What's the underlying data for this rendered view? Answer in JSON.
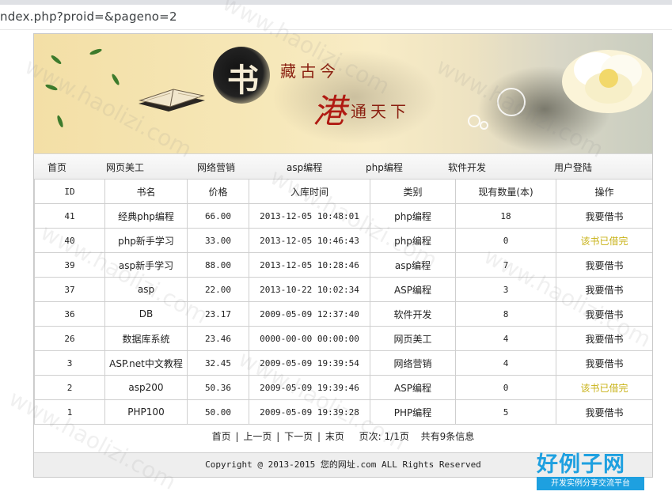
{
  "browser": {
    "url": "ndex.php?proid=&pageno=2"
  },
  "banner": {
    "glyph": "书",
    "line1": "藏古今",
    "line2": "港",
    "line3": "通天下"
  },
  "nav": [
    "首页",
    "网页美工",
    "网络营销",
    "asp编程",
    "php编程",
    "软件开发",
    "用户登陆"
  ],
  "table": {
    "headers": [
      "ID",
      "书名",
      "价格",
      "入库时间",
      "类别",
      "现有数量(本)",
      "操作"
    ],
    "rows": [
      {
        "id": "41",
        "name": "经典php编程",
        "price": "66.00",
        "time": "2013-12-05 10:48:01",
        "category": "php编程",
        "qty": "18",
        "action": "我要借书",
        "action_state": "available"
      },
      {
        "id": "40",
        "name": "php新手学习",
        "price": "33.00",
        "time": "2013-12-05 10:46:43",
        "category": "php编程",
        "qty": "0",
        "action": "该书已借完",
        "action_state": "out"
      },
      {
        "id": "39",
        "name": "asp新手学习",
        "price": "88.00",
        "time": "2013-12-05 10:28:46",
        "category": "asp编程",
        "qty": "7",
        "action": "我要借书",
        "action_state": "available"
      },
      {
        "id": "37",
        "name": "asp",
        "price": "22.00",
        "time": "2013-10-22 10:02:34",
        "category": "ASP编程",
        "qty": "3",
        "action": "我要借书",
        "action_state": "available"
      },
      {
        "id": "36",
        "name": "DB",
        "price": "23.17",
        "time": "2009-05-09 12:37:40",
        "category": "软件开发",
        "qty": "8",
        "action": "我要借书",
        "action_state": "available"
      },
      {
        "id": "26",
        "name": "数据库系统",
        "price": "23.46",
        "time": "0000-00-00 00:00:00",
        "category": "网页美工",
        "qty": "4",
        "action": "我要借书",
        "action_state": "available"
      },
      {
        "id": "3",
        "name": "ASP.net中文教程",
        "price": "32.45",
        "time": "2009-05-09 19:39:54",
        "category": "网络营销",
        "qty": "4",
        "action": "我要借书",
        "action_state": "available"
      },
      {
        "id": "2",
        "name": "asp200",
        "price": "50.36",
        "time": "2009-05-09 19:39:46",
        "category": "ASP编程",
        "qty": "0",
        "action": "该书已借完",
        "action_state": "out"
      },
      {
        "id": "1",
        "name": "PHP100",
        "price": "50.00",
        "time": "2009-05-09 19:39:28",
        "category": "PHP编程",
        "qty": "5",
        "action": "我要借书",
        "action_state": "available"
      }
    ]
  },
  "pager": {
    "first": "首页",
    "prev": "上一页",
    "next": "下一页",
    "last": "末页",
    "pages": "页次: 1/1页",
    "total": "共有9条信息"
  },
  "footer": {
    "copyright": "Copyright @ 2013-2015 您的网址.com ALL Rights Reserved"
  },
  "watermark": {
    "text": "www.haolizi.com"
  },
  "logo": {
    "main": "好例子网",
    "sub": "开发实例分享交流平台"
  },
  "colors": {
    "accent_done": "#c8b217",
    "logo_blue": "#1ea0e0"
  }
}
